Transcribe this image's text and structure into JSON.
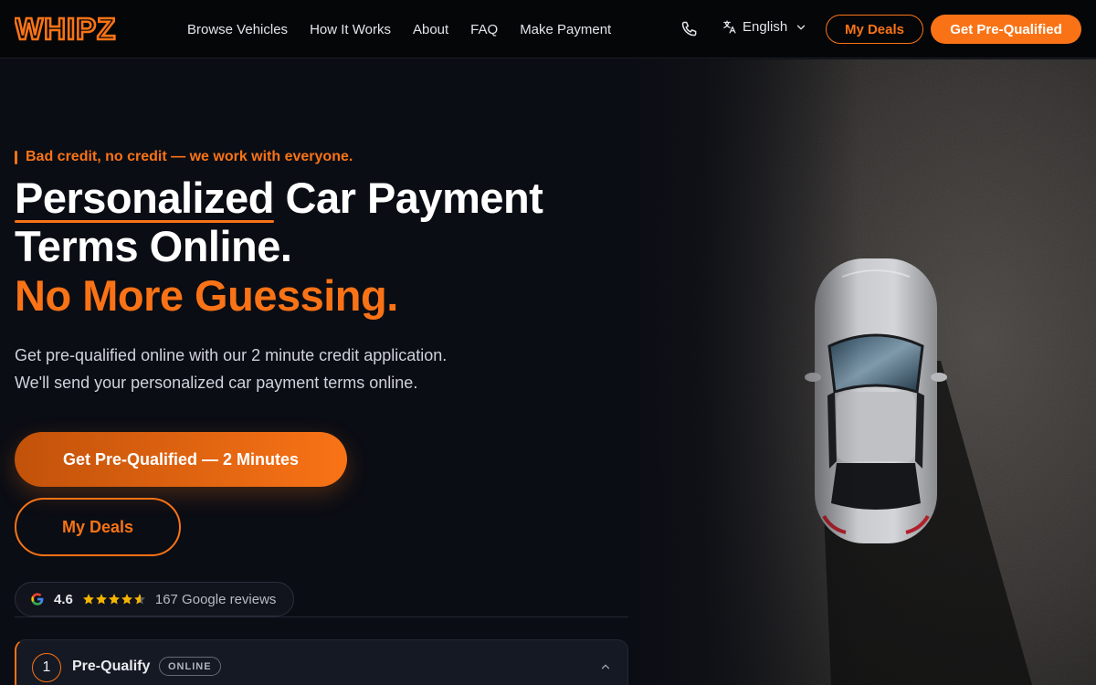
{
  "brand": {
    "logo_text": "WHIPZ",
    "accent": "#f97316"
  },
  "nav": {
    "links": [
      "Browse Vehicles",
      "How It Works",
      "About",
      "FAQ",
      "Make Payment"
    ],
    "language": "English",
    "my_deals": "My Deals",
    "get_prequalified": "Get Pre-Qualified"
  },
  "hero": {
    "tagline": "Bad credit, no credit — we work with everyone.",
    "title_word": "Personalized",
    "title_rest": " Car Payment",
    "title_line2": "Terms Online.",
    "title_line3": "No More Guessing.",
    "sub_line1": "Get pre-qualified online with our 2 minute credit application.",
    "sub_line2": "We'll send your personalized car payment terms online.",
    "cta_primary": "Get Pre-Qualified — 2 Minutes",
    "cta_secondary": "My Deals"
  },
  "reviews": {
    "rating": "4.6",
    "stars": 4.6,
    "count_text": "167 Google reviews"
  },
  "steps": [
    {
      "number": "1",
      "title": "Pre-Qualify",
      "badge": "ONLINE",
      "expanded": true
    }
  ],
  "icons": [
    "phone-icon",
    "translate-icon",
    "chevron-down-icon",
    "google-icon",
    "star-icon",
    "chevron-up-icon"
  ]
}
